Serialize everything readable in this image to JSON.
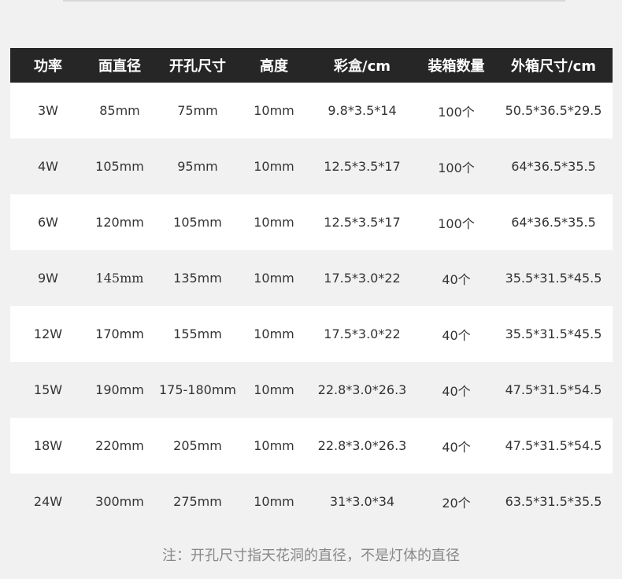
{
  "table": {
    "headers": [
      "功率",
      "面直径",
      "开孔尺寸",
      "高度",
      "彩盒/cm",
      "装箱数量",
      "外箱尺寸/cm"
    ],
    "rows": [
      [
        "3W",
        "85mm",
        "75mm",
        "10mm",
        "9.8*3.5*14",
        "100个",
        "50.5*36.5*29.5"
      ],
      [
        "4W",
        "105mm",
        "95mm",
        "10mm",
        "12.5*3.5*17",
        "100个",
        "64*36.5*35.5"
      ],
      [
        "6W",
        "120mm",
        "105mm",
        "10mm",
        "12.5*3.5*17",
        "100个",
        "64*36.5*35.5"
      ],
      [
        "9W",
        "145mm",
        "135mm",
        "10mm",
        "17.5*3.0*22",
        "40个",
        "35.5*31.5*45.5"
      ],
      [
        "12W",
        "170mm",
        "155mm",
        "10mm",
        "17.5*3.0*22",
        "40个",
        "35.5*31.5*45.5"
      ],
      [
        "15W",
        "190mm",
        "175-180mm",
        "10mm",
        "22.8*3.0*26.3",
        "40个",
        "47.5*31.5*54.5"
      ],
      [
        "18W",
        "220mm",
        "205mm",
        "10mm",
        "22.8*3.0*26.3",
        "40个",
        "47.5*31.5*54.5"
      ],
      [
        "24W",
        "300mm",
        "275mm",
        "10mm",
        "31*3.0*34",
        "20个",
        "63.5*31.5*35.5"
      ]
    ]
  },
  "note": "注：开孔尺寸指天花洞的直径，不是灯体的直径",
  "colors": {
    "header_bg": "#262626",
    "header_text": "#ffffff",
    "row_light": "#ffffff",
    "row_gray": "#f1f1f1",
    "text": "#333333",
    "note_text": "#888888"
  }
}
